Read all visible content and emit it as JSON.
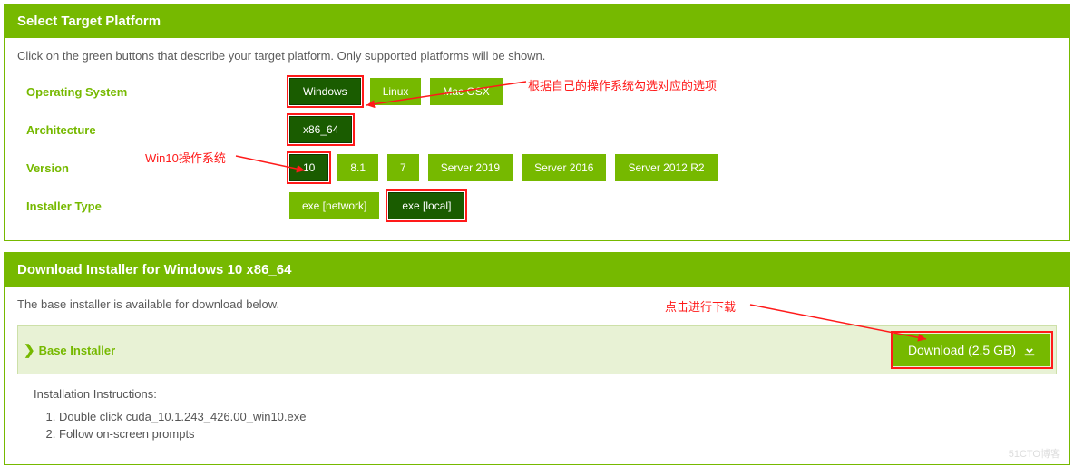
{
  "select": {
    "title": "Select Target Platform",
    "instruction": "Click on the green buttons that describe your target platform. Only supported platforms will be shown.",
    "rows": {
      "os": {
        "label": "Operating System",
        "options": [
          {
            "t": "Windows",
            "sel": true,
            "hl": true
          },
          {
            "t": "Linux"
          },
          {
            "t": "Mac OSX"
          }
        ]
      },
      "arch": {
        "label": "Architecture",
        "options": [
          {
            "t": "x86_64",
            "sel": true,
            "hl": true
          }
        ]
      },
      "ver": {
        "label": "Version",
        "options": [
          {
            "t": "10",
            "sel": true,
            "hl": true
          },
          {
            "t": "8.1"
          },
          {
            "t": "7"
          },
          {
            "t": "Server 2019"
          },
          {
            "t": "Server 2016"
          },
          {
            "t": "Server 2012 R2"
          }
        ]
      },
      "inst": {
        "label": "Installer Type",
        "options": [
          {
            "t": "exe [network]"
          },
          {
            "t": "exe [local]",
            "sel": true,
            "hl": true
          }
        ]
      }
    }
  },
  "download": {
    "title": "Download Installer for Windows 10 x86_64",
    "subtitle": "The base installer is available for download below.",
    "base_label": "Base Installer",
    "btn": "Download (2.5 GB)",
    "inst_title": "Installation Instructions:",
    "steps": [
      "Double click cuda_10.1.243_426.00_win10.exe",
      "Follow on-screen prompts"
    ]
  },
  "annotations": {
    "a1": "根据自己的操作系统勾选对应的选项",
    "a2": "Win10操作系统",
    "a3": "点击进行下载"
  },
  "watermark": "51CTO博客"
}
